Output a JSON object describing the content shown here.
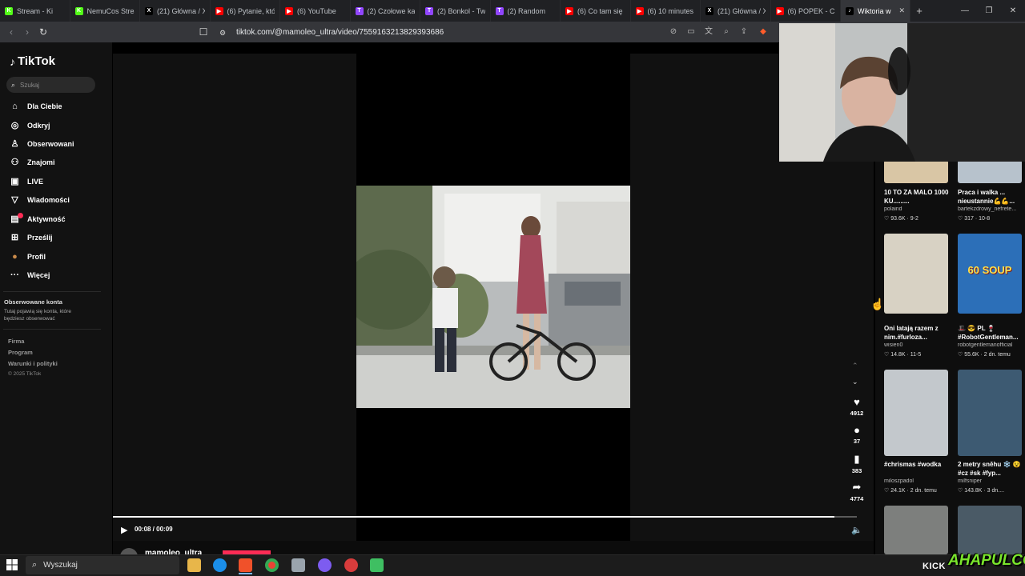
{
  "browser": {
    "tabs": [
      {
        "label": "Stream - Ki",
        "icon": "kick-icon",
        "color": "#53fc18",
        "glyph": "K"
      },
      {
        "label": "NemuCos Strea",
        "icon": "kick-icon",
        "color": "#53fc18",
        "glyph": "K"
      },
      {
        "label": "(21) Główna / X",
        "icon": "x-icon",
        "color": "#000000",
        "glyph": "X"
      },
      {
        "label": "(6) Pytanie, któ",
        "icon": "youtube-icon",
        "color": "#ff0000",
        "glyph": "▶"
      },
      {
        "label": "(6) YouTube",
        "icon": "youtube-icon",
        "color": "#ff0000",
        "glyph": "▶"
      },
      {
        "label": "(2) Czołowe ka",
        "icon": "twitch-icon",
        "color": "#9146ff",
        "glyph": "T"
      },
      {
        "label": "(2) Bonkol - Tw",
        "icon": "twitch-icon",
        "color": "#9146ff",
        "glyph": "T"
      },
      {
        "label": "(2) Random",
        "icon": "twitch-icon",
        "color": "#9146ff",
        "glyph": "T"
      },
      {
        "label": "(6) Co tam się",
        "icon": "youtube-icon",
        "color": "#ff0000",
        "glyph": "▶"
      },
      {
        "label": "(6) 10 minutes",
        "icon": "youtube-icon",
        "color": "#ff0000",
        "glyph": "▶"
      },
      {
        "label": "(21) Główna / X",
        "icon": "x-icon",
        "color": "#000000",
        "glyph": "X"
      },
      {
        "label": "(6) POPEK - CR",
        "icon": "youtube-icon",
        "color": "#ff0000",
        "glyph": "▶"
      },
      {
        "label": "Wiktoria w",
        "icon": "tiktok-icon",
        "color": "#000000",
        "glyph": "♪",
        "active": true
      }
    ],
    "new_tab": "+",
    "url": "tiktok.com/@mamoleo_ultra/video/7559163213829393686"
  },
  "sidebar": {
    "logo": "TikTok",
    "search_placeholder": "Szukaj",
    "nav": [
      {
        "label": "Dla Ciebie",
        "icon": "home-icon",
        "glyph": "⌂"
      },
      {
        "label": "Odkryj",
        "icon": "compass-icon",
        "glyph": "◎"
      },
      {
        "label": "Obserwowani",
        "icon": "user-plus-icon",
        "glyph": "♙"
      },
      {
        "label": "Znajomi",
        "icon": "friends-icon",
        "glyph": "⚇"
      },
      {
        "label": "LIVE",
        "icon": "live-icon",
        "glyph": "▣"
      },
      {
        "label": "Wiadomości",
        "icon": "message-icon",
        "glyph": "▽"
      },
      {
        "label": "Aktywność",
        "icon": "activity-icon",
        "glyph": "▤"
      },
      {
        "label": "Prześlij",
        "icon": "upload-icon",
        "glyph": "⊞"
      },
      {
        "label": "Profil",
        "icon": "avatar-icon",
        "glyph": "●"
      },
      {
        "label": "Więcej",
        "icon": "more-icon",
        "glyph": "···"
      }
    ],
    "followed_title": "Obserwowane konta",
    "followed_desc": "Tutaj pojawią się konta, które będziesz obserwować",
    "footer": [
      "Firma",
      "Program",
      "Warunki i polityki",
      "© 2025 TikTok"
    ]
  },
  "player": {
    "time": "00:08 / 00:09",
    "progress": 0.97,
    "author": "mamoleo_ultra"
  },
  "actions": [
    {
      "icon": "heart-icon",
      "glyph": "♥",
      "count": "4912"
    },
    {
      "icon": "comment-icon",
      "glyph": "●",
      "count": "37"
    },
    {
      "icon": "bookmark-icon",
      "glyph": "▮",
      "count": "383"
    },
    {
      "icon": "share-icon",
      "glyph": "➦",
      "count": "4774"
    }
  ],
  "related": [
    {
      "title": "10 TO ZA MALO 1000 KU.........",
      "author": "polaind",
      "stats": "♡ 93.6K · 9-2"
    },
    {
      "title": "Praca i walka ... nieustannie💪💪...",
      "author": "bartekzdrowy_nefrete...",
      "stats": "♡ 317 · 10-8"
    },
    {
      "title": "Oni latają razem z nim.#furloza...",
      "author": "wisien0",
      "stats": "♡ 14.8K · 11-5",
      "thumb_text": ""
    },
    {
      "title": "🎩 😎 PL 🍷 #RobotGentleman...",
      "author": "robotgentlemanofficial",
      "stats": "♡ 55.6K · 2 dn. temu",
      "thumb_text": "60 SOUP"
    },
    {
      "title": "#chrismas #wodka",
      "author": "miloszpadol",
      "stats": "♡ 24.1K · 2 dn. temu"
    },
    {
      "title": "2 metry sněhu ❄️ 😵 #cz #sk #fyp...",
      "author": "milfsniper",
      "stats": "♡ 143.8K · 3 dn...."
    }
  ],
  "taskbar": {
    "search_placeholder": "Wyszukaj",
    "stream_platform": "KICK",
    "brand": "AHAPULCO"
  }
}
